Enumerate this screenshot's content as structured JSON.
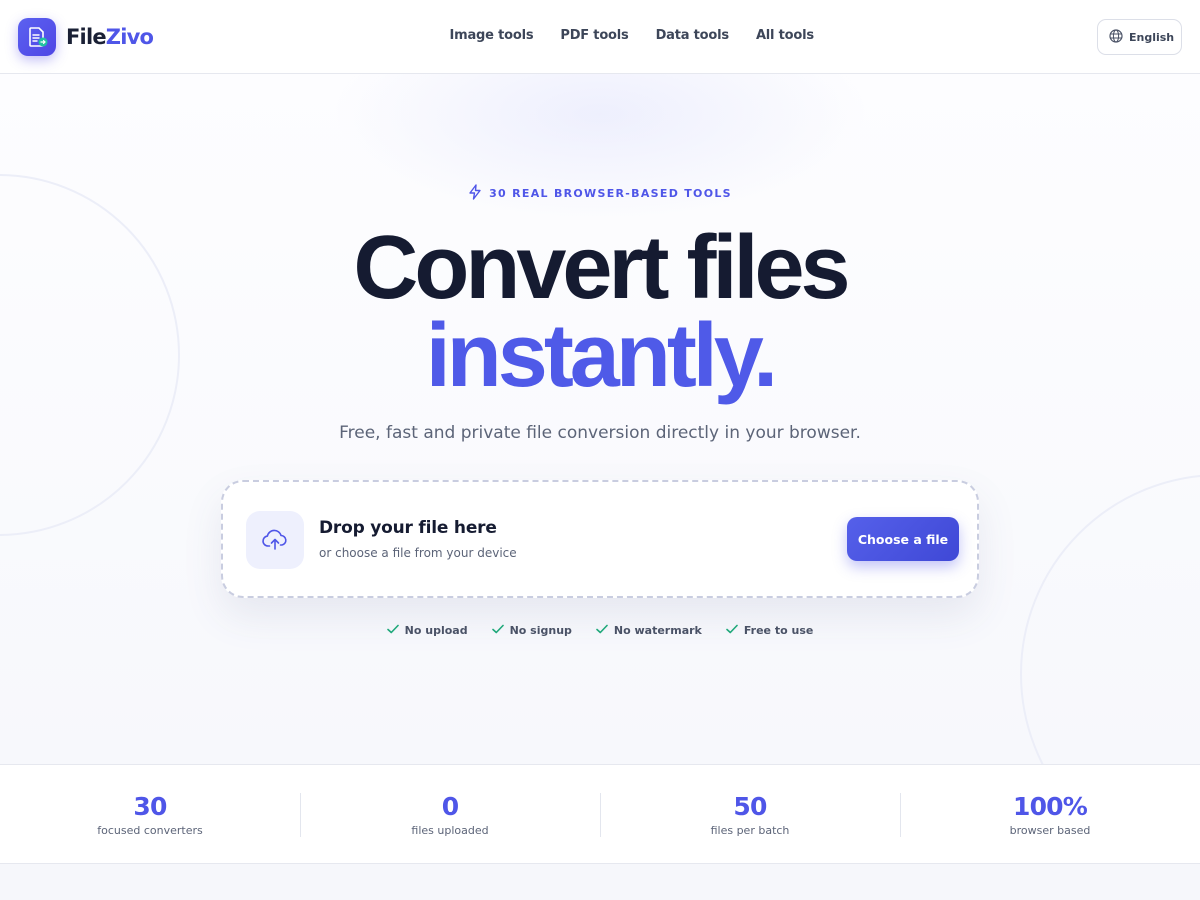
{
  "brand": {
    "name_part1": "File",
    "name_part2": "Zivo",
    "logo_icon": "document-convert-icon"
  },
  "nav": {
    "items": [
      {
        "label": "Image tools"
      },
      {
        "label": "PDF tools"
      },
      {
        "label": "Data tools"
      },
      {
        "label": "All tools"
      }
    ],
    "language": {
      "label": "English",
      "icon": "globe-icon"
    }
  },
  "hero": {
    "eyebrow": "30 REAL BROWSER-BASED TOOLS",
    "eyebrow_icon": "lightning-icon",
    "headline_line1": "Convert files",
    "headline_line2": "instantly.",
    "subtitle": "Free, fast and private file conversion directly in your browser."
  },
  "dropzone": {
    "icon": "cloud-upload-icon",
    "title": "Drop your file here",
    "subtitle": "or choose a file from your device",
    "button_label": "Choose a file"
  },
  "features": [
    {
      "label": "No upload"
    },
    {
      "label": "No signup"
    },
    {
      "label": "No watermark"
    },
    {
      "label": "Free to use"
    }
  ],
  "stats": [
    {
      "value": "30",
      "label": "focused converters"
    },
    {
      "value": "0",
      "label": "files uploaded"
    },
    {
      "value": "50",
      "label": "files per batch"
    },
    {
      "value": "100%",
      "label": "browser based"
    }
  ],
  "colors": {
    "accent": "#4f56e8",
    "heading": "#151b31",
    "check": "#1fa87a"
  }
}
